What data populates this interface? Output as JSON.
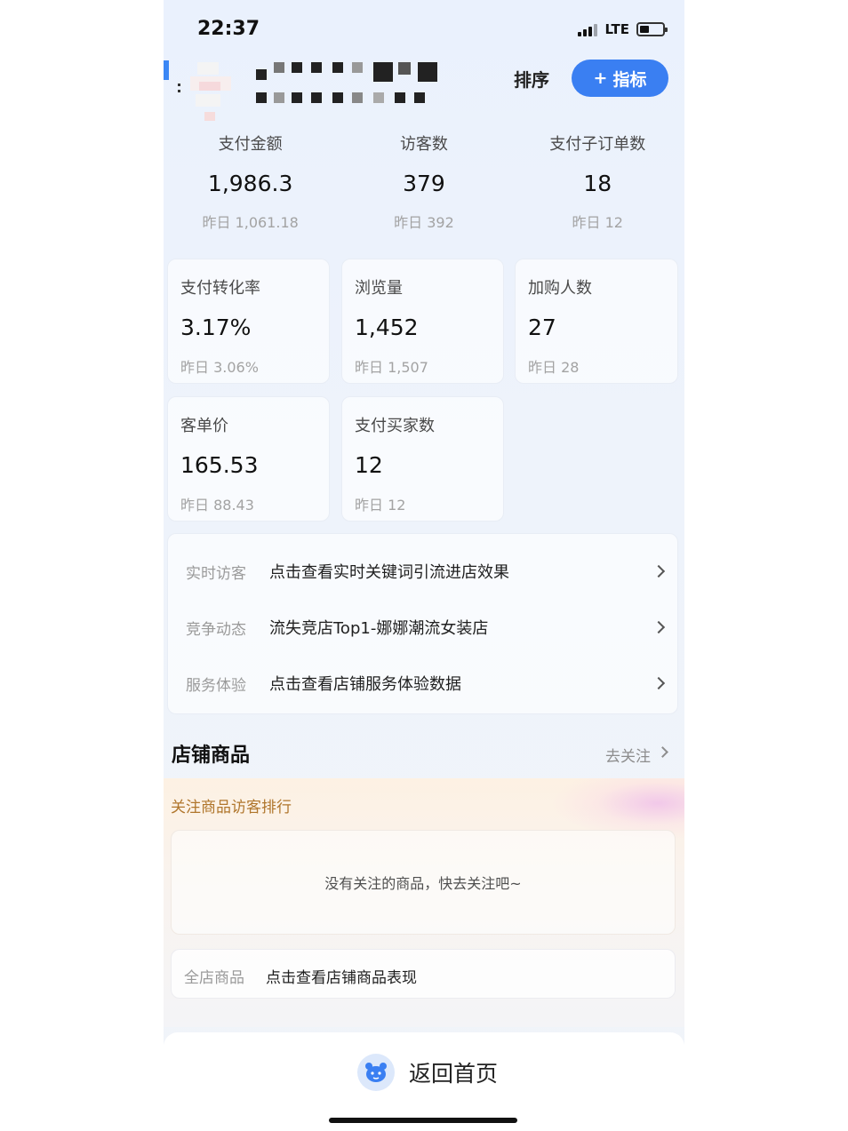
{
  "status_bar": {
    "time": "22:37",
    "network": "LTE"
  },
  "header": {
    "sort_label": "排序",
    "metric_label": "指标"
  },
  "top_stats": [
    {
      "label": "支付金额",
      "value": "1,986.3",
      "yesterday": "昨日 1,061.18"
    },
    {
      "label": "访客数",
      "value": "379",
      "yesterday": "昨日 392"
    },
    {
      "label": "支付子订单数",
      "value": "18",
      "yesterday": "昨日 12"
    }
  ],
  "cards": [
    {
      "label": "支付转化率",
      "value": "3.17%",
      "yesterday": "昨日 3.06%"
    },
    {
      "label": "浏览量",
      "value": "1,452",
      "yesterday": "昨日 1,507"
    },
    {
      "label": "加购人数",
      "value": "27",
      "yesterday": "昨日 28"
    },
    {
      "label": "客单价",
      "value": "165.53",
      "yesterday": "昨日 88.43"
    },
    {
      "label": "支付买家数",
      "value": "12",
      "yesterday": "昨日 12"
    }
  ],
  "links": [
    {
      "key": "实时访客",
      "text": "点击查看实时关键词引流进店效果"
    },
    {
      "key": "竞争动态",
      "text": "流失竞店Top1-娜娜潮流女装店"
    },
    {
      "key": "服务体验",
      "text": "点击查看店铺服务体验数据"
    }
  ],
  "goods_section": {
    "title": "店铺商品",
    "follow_link": "去关注",
    "follow_title": "关注商品访客排行",
    "empty_text": "没有关注的商品，快去关注吧~",
    "all_goods_key": "全店商品",
    "all_goods_text": "点击查看店铺商品表现"
  },
  "bottom": {
    "home_label": "返回首页"
  },
  "colors": {
    "accent": "#3a7ff2",
    "follow_title": "#b0762c",
    "muted": "#a3a3a3"
  }
}
